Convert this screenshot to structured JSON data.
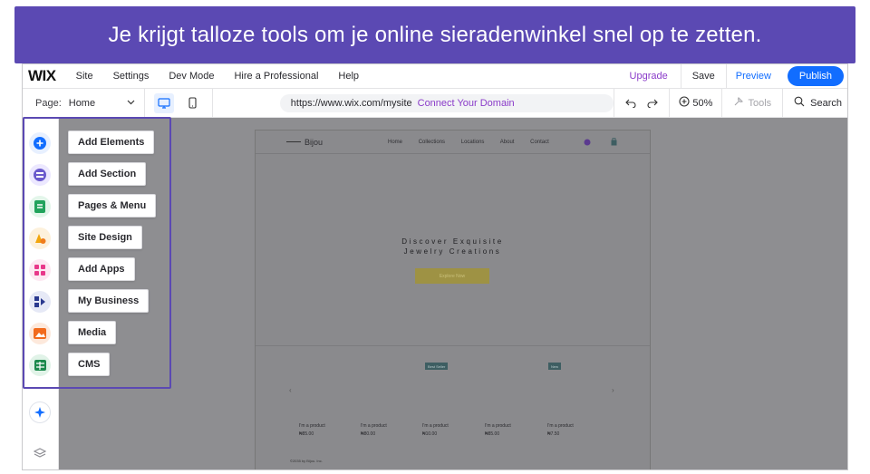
{
  "banner": {
    "text": "Je krijgt talloze tools om je online sieradenwinkel snel op te zetten."
  },
  "topbar": {
    "logo": "WIX",
    "menu": [
      "Site",
      "Settings",
      "Dev Mode",
      "Hire a Professional",
      "Help"
    ],
    "upgrade": "Upgrade",
    "save": "Save",
    "preview": "Preview",
    "publish": "Publish"
  },
  "toolbar": {
    "page_label": "Page:",
    "page_value": "Home",
    "url": "https://www.wix.com/mysite",
    "connect_domain": "Connect Your Domain",
    "zoom": "50%",
    "tools": "Tools",
    "search": "Search"
  },
  "rail": {
    "icons": [
      {
        "name": "add-elements-icon",
        "color": "#116dff"
      },
      {
        "name": "add-section-icon",
        "color": "#6a5acd"
      },
      {
        "name": "pages-menu-icon",
        "color": "#21a35b"
      },
      {
        "name": "site-design-icon",
        "color": "#f2a60c"
      },
      {
        "name": "add-apps-icon",
        "color": "#e8388a"
      },
      {
        "name": "my-business-icon",
        "color": "#2b3a8f"
      },
      {
        "name": "media-icon",
        "color": "#f26b1d"
      },
      {
        "name": "cms-icon",
        "color": "#1c8a4d"
      },
      {
        "name": "ai-sparkle-icon",
        "color": "#116dff"
      },
      {
        "name": "layers-icon",
        "color": "#8a8a90"
      }
    ]
  },
  "panel": {
    "items": [
      "Add Elements",
      "Add Section",
      "Pages & Menu",
      "Site Design",
      "Add Apps",
      "My Business",
      "Media",
      "CMS"
    ]
  },
  "site": {
    "brand": "Bijou",
    "nav": [
      "Home",
      "Collections",
      "Locations",
      "About",
      "Contact"
    ],
    "hero_line1": "Discover Exquisite",
    "hero_line2": "Jewelry Creations",
    "explore": "Explore Now",
    "badges": [
      "Best Seller",
      "New"
    ],
    "products": [
      {
        "name": "I'm a product",
        "price": "₦85.00"
      },
      {
        "name": "I'm a product",
        "price": "₦80.00"
      },
      {
        "name": "I'm a product",
        "price": "₦10.00"
      },
      {
        "name": "I'm a product",
        "price": "₦85.00"
      },
      {
        "name": "I'm a product",
        "price": "₦7.50"
      }
    ],
    "footer": "©2035 by Bijou. Inc."
  }
}
